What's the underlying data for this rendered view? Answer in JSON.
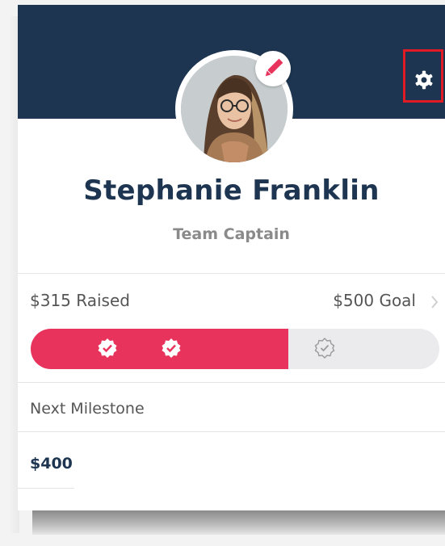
{
  "profile": {
    "name": "Stephanie Franklin",
    "role": "Team Captain"
  },
  "fundraising": {
    "raised_label": "$315 Raised",
    "goal_label": "$500 Goal",
    "progress_fraction": 0.63,
    "milestones_reached": 2,
    "milestones_total": 3
  },
  "milestone": {
    "label": "Next Milestone",
    "amount": "$400"
  },
  "icons": {
    "settings": "gear-icon",
    "edit": "pencil-icon",
    "goal": "chevron-right-icon",
    "milestone": "verified-badge-icon"
  },
  "colors": {
    "header": "#1d3550",
    "accent": "#e8335d",
    "highlight": "#e01b24"
  }
}
